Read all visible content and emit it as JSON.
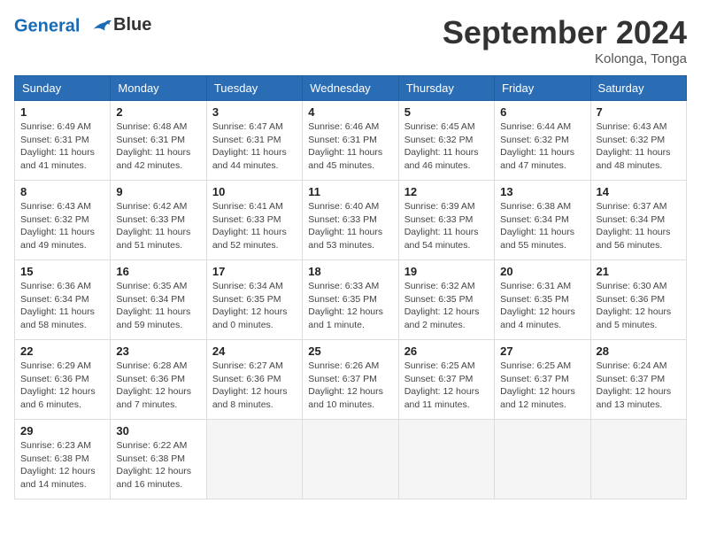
{
  "logo": {
    "line1": "General",
    "line2": "Blue"
  },
  "title": "September 2024",
  "location": "Kolonga, Tonga",
  "headers": [
    "Sunday",
    "Monday",
    "Tuesday",
    "Wednesday",
    "Thursday",
    "Friday",
    "Saturday"
  ],
  "weeks": [
    [
      {
        "day": "1",
        "info": "Sunrise: 6:49 AM\nSunset: 6:31 PM\nDaylight: 11 hours\nand 41 minutes."
      },
      {
        "day": "2",
        "info": "Sunrise: 6:48 AM\nSunset: 6:31 PM\nDaylight: 11 hours\nand 42 minutes."
      },
      {
        "day": "3",
        "info": "Sunrise: 6:47 AM\nSunset: 6:31 PM\nDaylight: 11 hours\nand 44 minutes."
      },
      {
        "day": "4",
        "info": "Sunrise: 6:46 AM\nSunset: 6:31 PM\nDaylight: 11 hours\nand 45 minutes."
      },
      {
        "day": "5",
        "info": "Sunrise: 6:45 AM\nSunset: 6:32 PM\nDaylight: 11 hours\nand 46 minutes."
      },
      {
        "day": "6",
        "info": "Sunrise: 6:44 AM\nSunset: 6:32 PM\nDaylight: 11 hours\nand 47 minutes."
      },
      {
        "day": "7",
        "info": "Sunrise: 6:43 AM\nSunset: 6:32 PM\nDaylight: 11 hours\nand 48 minutes."
      }
    ],
    [
      {
        "day": "8",
        "info": "Sunrise: 6:43 AM\nSunset: 6:32 PM\nDaylight: 11 hours\nand 49 minutes."
      },
      {
        "day": "9",
        "info": "Sunrise: 6:42 AM\nSunset: 6:33 PM\nDaylight: 11 hours\nand 51 minutes."
      },
      {
        "day": "10",
        "info": "Sunrise: 6:41 AM\nSunset: 6:33 PM\nDaylight: 11 hours\nand 52 minutes."
      },
      {
        "day": "11",
        "info": "Sunrise: 6:40 AM\nSunset: 6:33 PM\nDaylight: 11 hours\nand 53 minutes."
      },
      {
        "day": "12",
        "info": "Sunrise: 6:39 AM\nSunset: 6:33 PM\nDaylight: 11 hours\nand 54 minutes."
      },
      {
        "day": "13",
        "info": "Sunrise: 6:38 AM\nSunset: 6:34 PM\nDaylight: 11 hours\nand 55 minutes."
      },
      {
        "day": "14",
        "info": "Sunrise: 6:37 AM\nSunset: 6:34 PM\nDaylight: 11 hours\nand 56 minutes."
      }
    ],
    [
      {
        "day": "15",
        "info": "Sunrise: 6:36 AM\nSunset: 6:34 PM\nDaylight: 11 hours\nand 58 minutes."
      },
      {
        "day": "16",
        "info": "Sunrise: 6:35 AM\nSunset: 6:34 PM\nDaylight: 11 hours\nand 59 minutes."
      },
      {
        "day": "17",
        "info": "Sunrise: 6:34 AM\nSunset: 6:35 PM\nDaylight: 12 hours\nand 0 minutes."
      },
      {
        "day": "18",
        "info": "Sunrise: 6:33 AM\nSunset: 6:35 PM\nDaylight: 12 hours\nand 1 minute."
      },
      {
        "day": "19",
        "info": "Sunrise: 6:32 AM\nSunset: 6:35 PM\nDaylight: 12 hours\nand 2 minutes."
      },
      {
        "day": "20",
        "info": "Sunrise: 6:31 AM\nSunset: 6:35 PM\nDaylight: 12 hours\nand 4 minutes."
      },
      {
        "day": "21",
        "info": "Sunrise: 6:30 AM\nSunset: 6:36 PM\nDaylight: 12 hours\nand 5 minutes."
      }
    ],
    [
      {
        "day": "22",
        "info": "Sunrise: 6:29 AM\nSunset: 6:36 PM\nDaylight: 12 hours\nand 6 minutes."
      },
      {
        "day": "23",
        "info": "Sunrise: 6:28 AM\nSunset: 6:36 PM\nDaylight: 12 hours\nand 7 minutes."
      },
      {
        "day": "24",
        "info": "Sunrise: 6:27 AM\nSunset: 6:36 PM\nDaylight: 12 hours\nand 8 minutes."
      },
      {
        "day": "25",
        "info": "Sunrise: 6:26 AM\nSunset: 6:37 PM\nDaylight: 12 hours\nand 10 minutes."
      },
      {
        "day": "26",
        "info": "Sunrise: 6:25 AM\nSunset: 6:37 PM\nDaylight: 12 hours\nand 11 minutes."
      },
      {
        "day": "27",
        "info": "Sunrise: 6:25 AM\nSunset: 6:37 PM\nDaylight: 12 hours\nand 12 minutes."
      },
      {
        "day": "28",
        "info": "Sunrise: 6:24 AM\nSunset: 6:37 PM\nDaylight: 12 hours\nand 13 minutes."
      }
    ],
    [
      {
        "day": "29",
        "info": "Sunrise: 6:23 AM\nSunset: 6:38 PM\nDaylight: 12 hours\nand 14 minutes."
      },
      {
        "day": "30",
        "info": "Sunrise: 6:22 AM\nSunset: 6:38 PM\nDaylight: 12 hours\nand 16 minutes."
      },
      {
        "day": "",
        "info": ""
      },
      {
        "day": "",
        "info": ""
      },
      {
        "day": "",
        "info": ""
      },
      {
        "day": "",
        "info": ""
      },
      {
        "day": "",
        "info": ""
      }
    ]
  ]
}
